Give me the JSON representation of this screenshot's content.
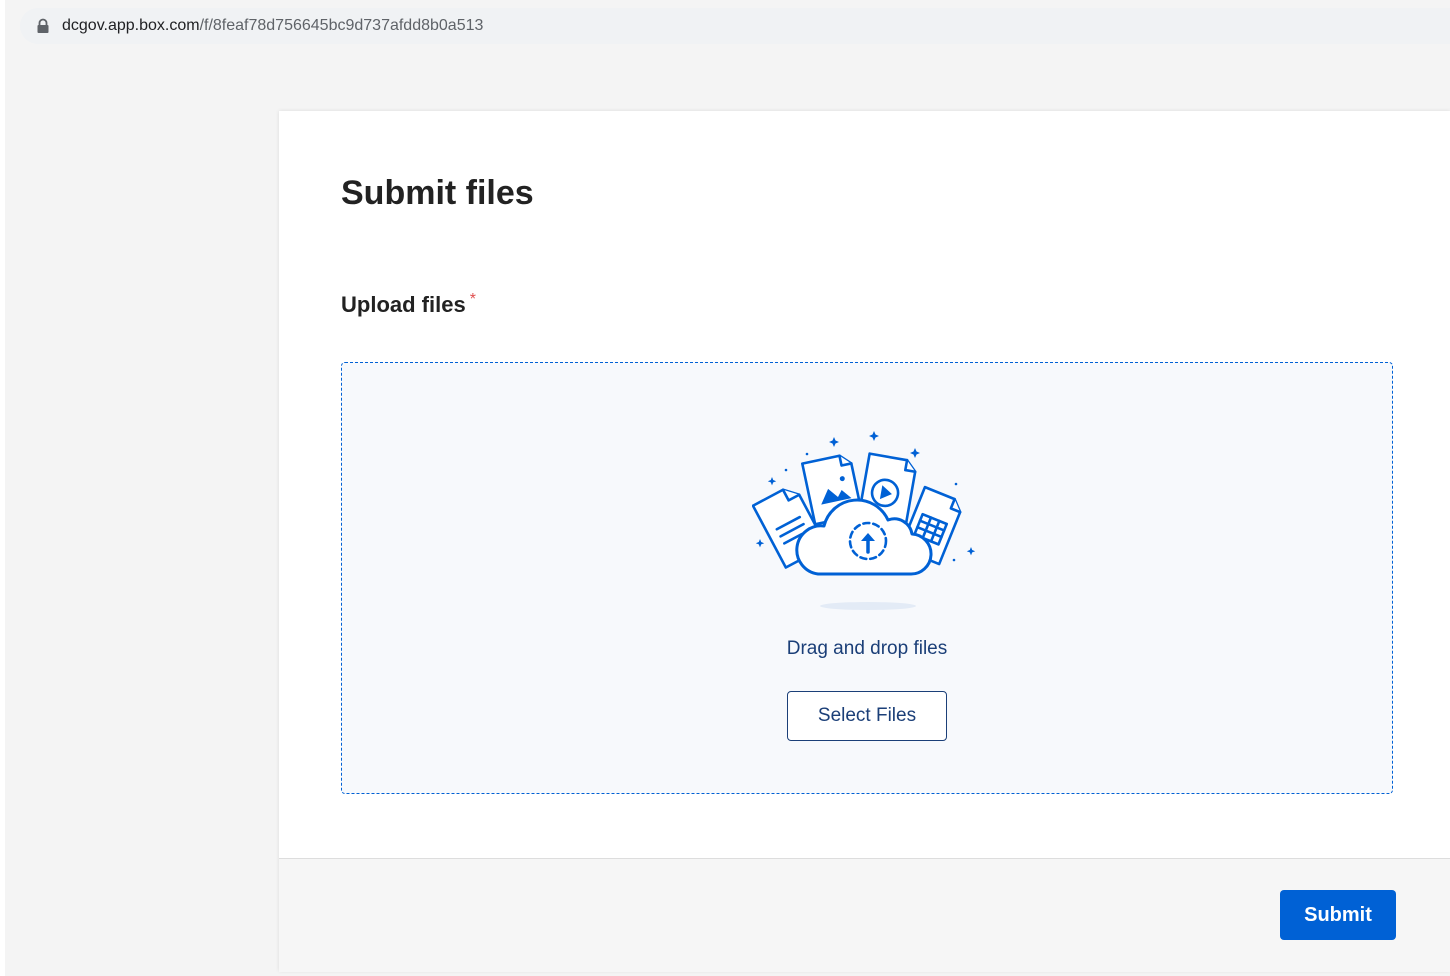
{
  "browser": {
    "url_host": "dcgov.app.box.com",
    "url_path": "/f/8feaf78d756645bc9d737afdd8b0a513",
    "lock_icon": "lock-icon"
  },
  "form": {
    "title": "Submit files",
    "upload_label": "Upload files",
    "required_marker": "*",
    "required_color": "#e05050"
  },
  "drop_zone": {
    "illustration_icon": "cloud-upload-files-icon",
    "instruction": "Drag and drop files",
    "select_button_label": "Select Files"
  },
  "footer": {
    "submit_label": "Submit"
  },
  "colors": {
    "accent": "#0061d5",
    "text_dark": "#222222",
    "drop_text": "#1b3f78"
  }
}
